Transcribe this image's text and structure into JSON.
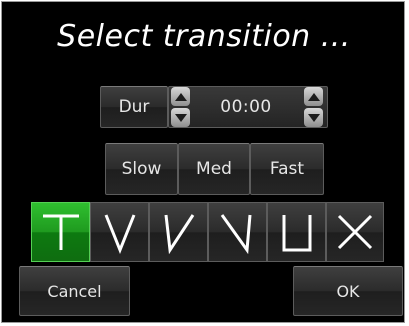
{
  "dialog": {
    "title": "Select transition ..."
  },
  "duration": {
    "label": "Dur",
    "value": "00:00"
  },
  "speed_buttons": [
    {
      "label": "Slow"
    },
    {
      "label": "Med"
    },
    {
      "label": "Fast"
    }
  ],
  "transitions": [
    {
      "icon": "transition-t-icon",
      "selected": true
    },
    {
      "icon": "transition-v-icon",
      "selected": false
    },
    {
      "icon": "transition-slant-v-icon",
      "selected": false
    },
    {
      "icon": "transition-backslash-icon",
      "selected": false
    },
    {
      "icon": "transition-u-icon",
      "selected": false
    },
    {
      "icon": "transition-x-icon",
      "selected": false
    }
  ],
  "actions": {
    "cancel_label": "Cancel",
    "ok_label": "OK"
  },
  "colors": {
    "background": "#000000",
    "selected": "#1f9a1f",
    "text": "#e6e6e6"
  }
}
